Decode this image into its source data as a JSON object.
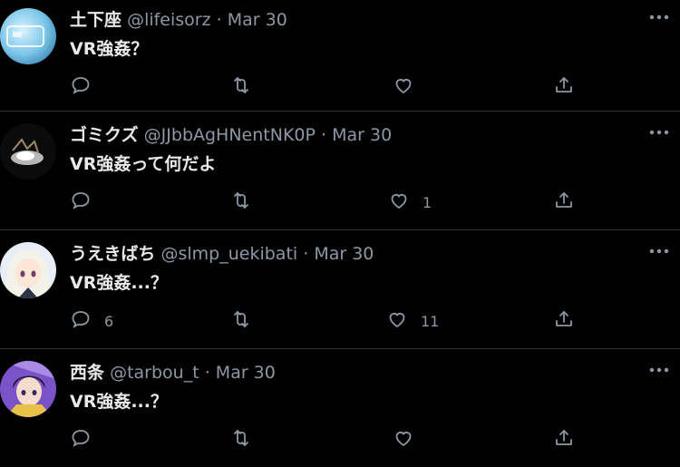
{
  "tweets": [
    {
      "name": "土下座",
      "handle": "@lifeisorz",
      "dot": "·",
      "date": "Mar 30",
      "text": "VR強姦？",
      "reply_count": "",
      "like_count": ""
    },
    {
      "name": "ゴミクズ",
      "handle": "@JJbbAgHNentNK0P",
      "dot": "·",
      "date": "Mar 30",
      "text": "VR強姦って何だよ",
      "reply_count": "",
      "like_count": "1"
    },
    {
      "name": "うえきばち",
      "handle": "@slmp_uekibati",
      "dot": "·",
      "date": "Mar 30",
      "text": "VR強姦...？",
      "reply_count": "6",
      "like_count": "11"
    },
    {
      "name": "西条",
      "handle": "@tarbou_t",
      "dot": "·",
      "date": "Mar 30",
      "text": "VR強姦...？",
      "reply_count": "",
      "like_count": ""
    }
  ],
  "icons": [
    "reply-icon",
    "retweet-icon",
    "like-icon",
    "share-icon",
    "more-icon"
  ],
  "colors": {
    "background": "#000000",
    "divider": "#2f3336",
    "muted": "#8b98a5",
    "text": "#e7e9ea"
  }
}
